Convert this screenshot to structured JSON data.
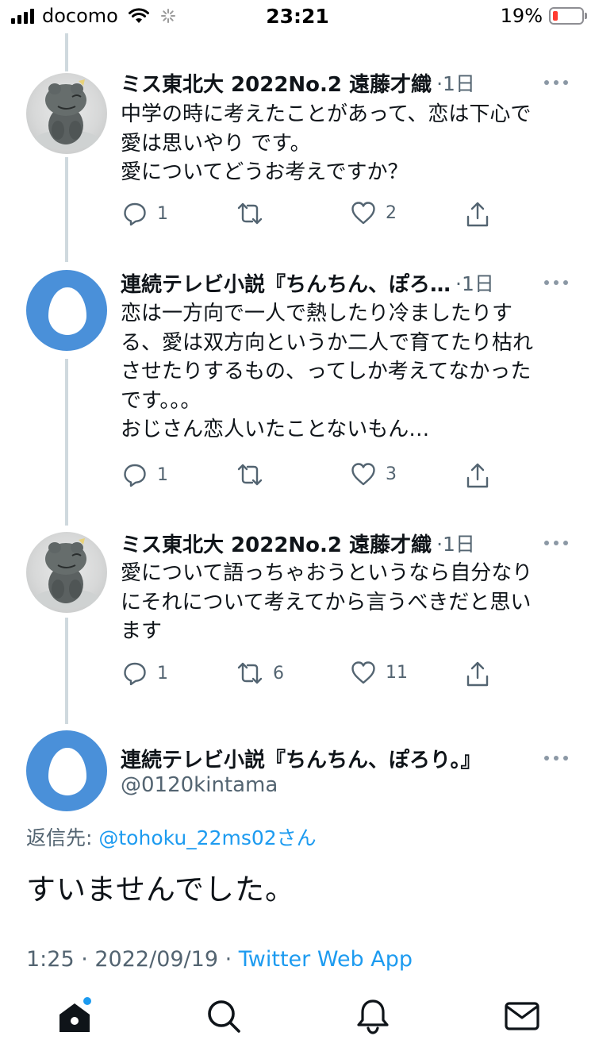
{
  "status_bar": {
    "carrier": "docomo",
    "time": "23:21",
    "battery_percent": "19%",
    "battery_level": 0.19
  },
  "tweets": [
    {
      "author": "ミス東北大 2022No.2 遠藤才織",
      "age": "·1日",
      "text": "中学の時に考えたことがあって、恋は下心で\n愛は思いやり です。\n愛についてどうお考えですか？",
      "replies": "1",
      "retweets": "",
      "likes": "2"
    },
    {
      "author": "連続テレビ小説『ちんちん、ぽろ…",
      "age": "·1日",
      "text": "恋は一方向で一人で熱したり冷ましたりす\nる、愛は双方向というか二人で育てたり枯れ\nさせたりするもの、ってしか考えてなかった\nです。。。\nおじさん恋人いたことないもん…",
      "replies": "1",
      "retweets": "",
      "likes": "3"
    },
    {
      "author": "ミス東北大 2022No.2 遠藤才織",
      "age": "·1日",
      "text": "愛について語っちゃおうというなら自分なり\nにそれについて考えてから言うべきだと思い\nます",
      "replies": "1",
      "retweets": "6",
      "likes": "11"
    }
  ],
  "focal_tweet": {
    "author": "連続テレビ小説『ちんちん、ぽろり。』",
    "handle": "@0120kintama",
    "reply_prefix": "返信先: ",
    "reply_mention": "@tohoku_22ms02",
    "reply_suffix": "さん",
    "text": "すいませんでした。",
    "timestamp": "1:25 · 2022/09/19 · ",
    "source": "Twitter Web App"
  },
  "tab_bar": {
    "icons": [
      "home-icon",
      "search-icon",
      "notifications-icon",
      "messages-icon"
    ]
  },
  "colors": {
    "accent": "#1d9bf0",
    "egg_avatar": "#4a90d9",
    "secondary_text": "#536471"
  }
}
